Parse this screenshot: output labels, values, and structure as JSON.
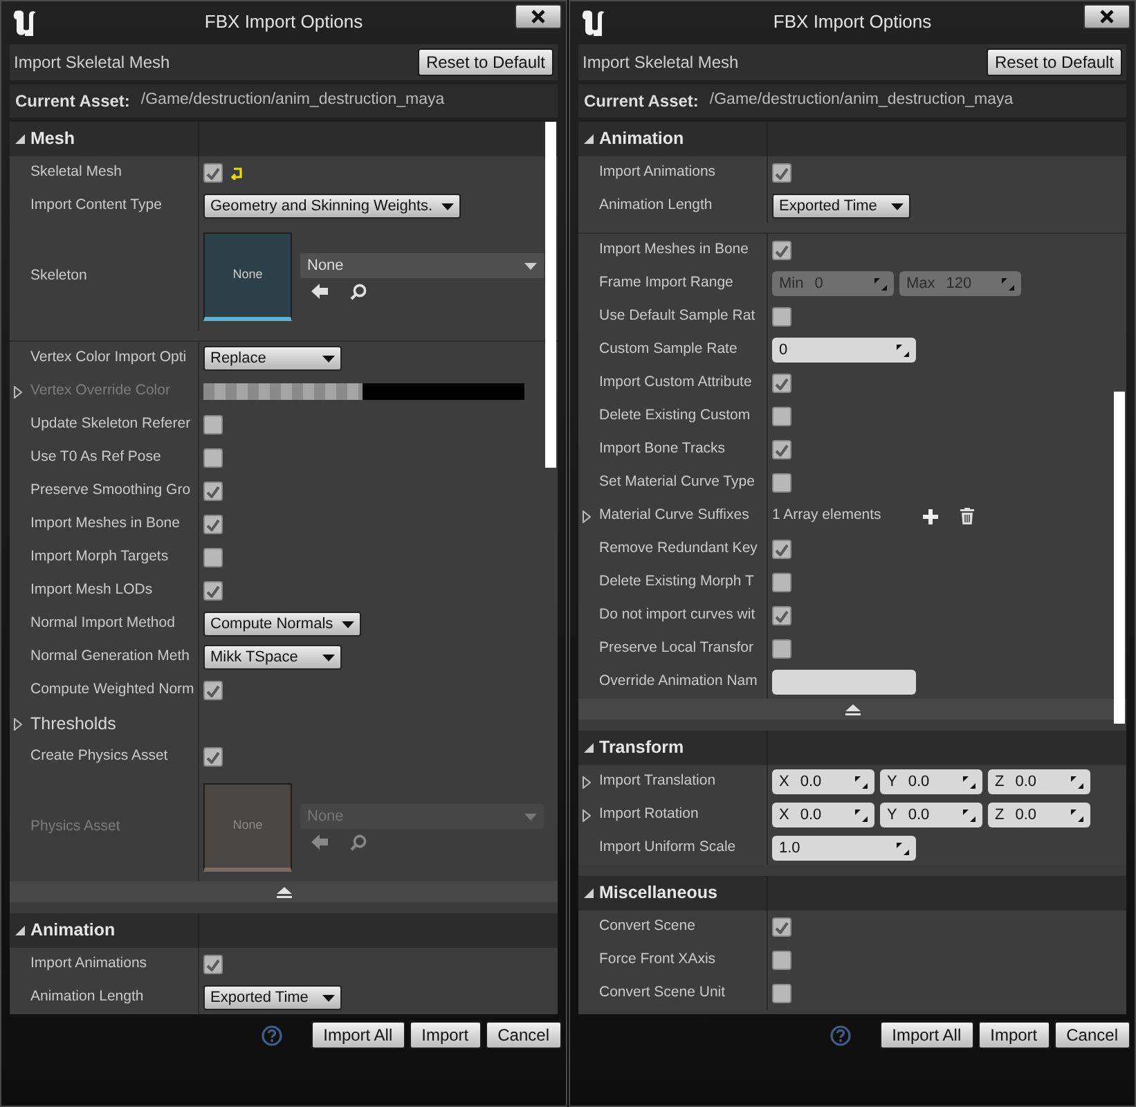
{
  "dialogs": [
    {
      "title": "FBX Import Options",
      "subtitle": "Import Skeletal Mesh",
      "reset_button": "Reset to Default",
      "asset_label": "Current Asset:",
      "asset_path": "/Game/destruction/anim_destruction_maya",
      "buttons": [
        "Import All",
        "Import",
        "Cancel"
      ],
      "sections": [
        {
          "title": "Mesh",
          "expanded": true,
          "collapse_bar": true,
          "rows": [
            {
              "kind": "checkbox",
              "label": "Skeletal Mesh",
              "checked": true,
              "show_reset": true
            },
            {
              "kind": "dropdown",
              "label": "Import Content Type",
              "value": "Geometry and Skinning Weights."
            },
            {
              "kind": "asset",
              "label": "Skeleton",
              "thumb": "None",
              "value": "None",
              "disabled": false
            },
            {
              "kind": "divider"
            },
            {
              "kind": "dropdown",
              "label": "Vertex Color Import Opti",
              "value": "Replace"
            },
            {
              "kind": "color",
              "label": "Vertex Override Color",
              "disabled": true,
              "expanded": false
            },
            {
              "kind": "checkbox",
              "label": "Update Skeleton Referer",
              "checked": false
            },
            {
              "kind": "checkbox",
              "label": "Use T0 As Ref Pose",
              "checked": false
            },
            {
              "kind": "checkbox",
              "label": "Preserve Smoothing Gro",
              "checked": true
            },
            {
              "kind": "checkbox",
              "label": "Import Meshes in Bone",
              "checked": true
            },
            {
              "kind": "checkbox",
              "label": "Import Morph Targets",
              "checked": false
            },
            {
              "kind": "checkbox",
              "label": "Import Mesh LODs",
              "checked": true
            },
            {
              "kind": "dropdown",
              "label": "Normal Import Method",
              "value": "Compute Normals"
            },
            {
              "kind": "dropdown",
              "label": "Normal Generation Meth",
              "value": "Mikk TSpace"
            },
            {
              "kind": "checkbox",
              "label": "Compute Weighted Norm",
              "checked": true
            },
            {
              "kind": "category",
              "label": "Thresholds",
              "expanded": false
            },
            {
              "kind": "checkbox",
              "label": "Create Physics Asset",
              "checked": true
            },
            {
              "kind": "asset",
              "label": "Physics Asset",
              "thumb": "None",
              "value": "None",
              "disabled": true
            }
          ]
        },
        {
          "title": "Animation",
          "expanded": true,
          "collapse_bar": false,
          "rows": [
            {
              "kind": "checkbox",
              "label": "Import Animations",
              "checked": true
            },
            {
              "kind": "dropdown",
              "label": "Animation Length",
              "value": "Exported Time"
            }
          ]
        }
      ]
    },
    {
      "title": "FBX Import Options",
      "subtitle": "Import Skeletal Mesh",
      "reset_button": "Reset to Default",
      "asset_label": "Current Asset:",
      "asset_path": "/Game/destruction/anim_destruction_maya",
      "buttons": [
        "Import All",
        "Import",
        "Cancel"
      ],
      "sections": [
        {
          "title": "Animation",
          "expanded": true,
          "collapse_bar": true,
          "rows": [
            {
              "kind": "checkbox",
              "label": "Import Animations",
              "checked": true
            },
            {
              "kind": "dropdown",
              "label": "Animation Length",
              "value": "Exported Time"
            },
            {
              "kind": "divider"
            },
            {
              "kind": "checkbox",
              "label": "Import Meshes in Bone",
              "checked": true
            },
            {
              "kind": "fields",
              "label": "Frame Import Range",
              "fields": [
                {
                  "prefix": "Min",
                  "value": "0",
                  "disabled": true
                },
                {
                  "prefix": "Max",
                  "value": "120",
                  "disabled": true
                }
              ]
            },
            {
              "kind": "checkbox",
              "label": "Use Default Sample Rat",
              "checked": false
            },
            {
              "kind": "fields",
              "label": "Custom Sample Rate",
              "fields": [
                {
                  "value": "0",
                  "disabled": false
                }
              ]
            },
            {
              "kind": "checkbox",
              "label": "Import Custom Attribute",
              "checked": true
            },
            {
              "kind": "checkbox",
              "label": "Delete Existing Custom",
              "checked": false
            },
            {
              "kind": "checkbox",
              "label": "Import Bone Tracks",
              "checked": true
            },
            {
              "kind": "checkbox",
              "label": "Set Material Curve Type",
              "checked": false
            },
            {
              "kind": "array",
              "label": "Material Curve Suffixes",
              "value": "1 Array elements",
              "expanded": false
            },
            {
              "kind": "checkbox",
              "label": "Remove Redundant Key",
              "checked": true
            },
            {
              "kind": "checkbox",
              "label": "Delete Existing Morph T",
              "checked": false
            },
            {
              "kind": "checkbox",
              "label": "Do not import curves wit",
              "checked": true
            },
            {
              "kind": "checkbox",
              "label": "Preserve Local Transfor",
              "checked": false
            },
            {
              "kind": "text",
              "label": "Override Animation Nam"
            }
          ]
        },
        {
          "title": "Transform",
          "expanded": true,
          "collapse_bar": false,
          "rows": [
            {
              "kind": "fields",
              "label": "Import Translation",
              "expanded": false,
              "fields": [
                {
                  "prefix": "X",
                  "value": "0.0",
                  "disabled": false
                },
                {
                  "prefix": "Y",
                  "value": "0.0",
                  "disabled": false
                },
                {
                  "prefix": "Z",
                  "value": "0.0",
                  "disabled": false
                }
              ]
            },
            {
              "kind": "fields",
              "label": "Import Rotation",
              "expanded": false,
              "fields": [
                {
                  "prefix": "X",
                  "value": "0.0",
                  "disabled": false
                },
                {
                  "prefix": "Y",
                  "value": "0.0",
                  "disabled": false
                },
                {
                  "prefix": "Z",
                  "value": "0.0",
                  "disabled": false
                }
              ]
            },
            {
              "kind": "fields",
              "label": "Import Uniform Scale",
              "fields": [
                {
                  "value": "1.0",
                  "disabled": false
                }
              ]
            }
          ]
        },
        {
          "title": "Miscellaneous",
          "expanded": true,
          "collapse_bar": false,
          "rows": [
            {
              "kind": "checkbox",
              "label": "Convert Scene",
              "checked": true
            },
            {
              "kind": "checkbox",
              "label": "Force Front XAxis",
              "checked": false
            },
            {
              "kind": "checkbox",
              "label": "Convert Scene Unit",
              "checked": false
            }
          ]
        }
      ]
    }
  ]
}
